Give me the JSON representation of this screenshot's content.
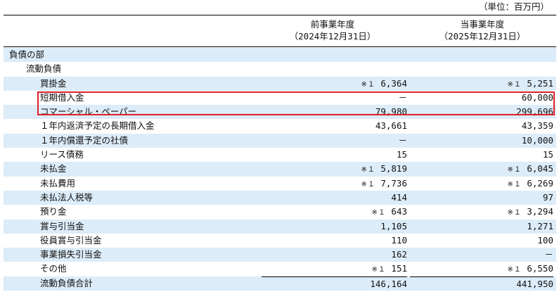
{
  "unit_label": "（単位：百万円）",
  "header": {
    "prev_title": "前事業年度",
    "prev_date": "（2024年12月31日）",
    "curr_title": "当事業年度",
    "curr_date": "（2025年12月31日）"
  },
  "rows": [
    {
      "label": "負債の部",
      "indent": 1,
      "prev": "",
      "curr": "",
      "shade": true
    },
    {
      "label": "流動負債",
      "indent": 2,
      "prev": "",
      "curr": "",
      "shade": false
    },
    {
      "label": "買掛金",
      "indent": 3,
      "prev": "6,364",
      "prev_mark": "※１",
      "curr": "5,251",
      "curr_mark": "※１",
      "shade": true
    },
    {
      "label": "短期借入金",
      "indent": 3,
      "prev": "－",
      "curr": "60,000",
      "shade": false
    },
    {
      "label": "コマーシャル・ペーパー",
      "indent": 3,
      "prev": "79,980",
      "curr": "299,696",
      "shade": true
    },
    {
      "label": "１年内返済予定の長期借入金",
      "indent": 3,
      "prev": "43,661",
      "curr": "43,359",
      "shade": false
    },
    {
      "label": "１年内償還予定の社債",
      "indent": 3,
      "prev": "－",
      "curr": "10,000",
      "shade": true
    },
    {
      "label": "リース債務",
      "indent": 3,
      "prev": "15",
      "curr": "15",
      "shade": false
    },
    {
      "label": "未払金",
      "indent": 3,
      "prev": "5,819",
      "prev_mark": "※１",
      "curr": "6,045",
      "curr_mark": "※１",
      "shade": true
    },
    {
      "label": "未払費用",
      "indent": 3,
      "prev": "7,736",
      "prev_mark": "※１",
      "curr": "6,269",
      "curr_mark": "※１",
      "shade": false
    },
    {
      "label": "未払法人税等",
      "indent": 3,
      "prev": "414",
      "curr": "97",
      "shade": true
    },
    {
      "label": "預り金",
      "indent": 3,
      "prev": "643",
      "prev_mark": "※１",
      "curr": "3,294",
      "curr_mark": "※１",
      "shade": false
    },
    {
      "label": "賞与引当金",
      "indent": 3,
      "prev": "1,105",
      "curr": "1,271",
      "shade": true
    },
    {
      "label": "役員賞与引当金",
      "indent": 3,
      "prev": "110",
      "curr": "100",
      "shade": false
    },
    {
      "label": "事業損失引当金",
      "indent": 3,
      "prev": "162",
      "curr": "－",
      "shade": true
    },
    {
      "label": "その他",
      "indent": 3,
      "prev": "151",
      "prev_mark": "※１",
      "curr": "6,550",
      "curr_mark": "※１",
      "shade": false
    },
    {
      "label": "流動負債合計",
      "indent": 3,
      "prev": "146,164",
      "curr": "441,950",
      "shade": true,
      "total": true
    }
  ]
}
